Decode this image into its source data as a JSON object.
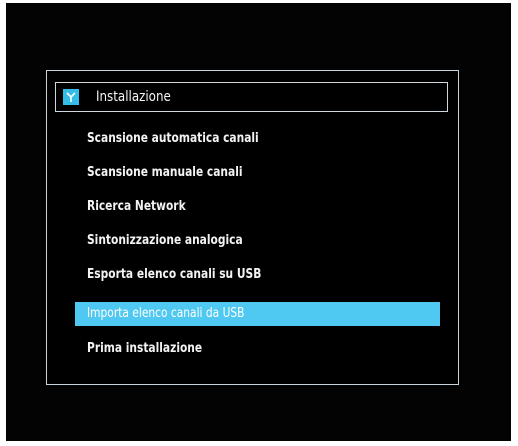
{
  "menu": {
    "title": "Installazione",
    "header_icon": "antenna-icon",
    "accent_color": "#4fc8f2",
    "selected_index": 5,
    "items": [
      {
        "label": "Scansione automatica canali"
      },
      {
        "label": "Scansione manuale canali"
      },
      {
        "label": "Ricerca Network"
      },
      {
        "label": "Sintonizzazione analogica"
      },
      {
        "label": "Esporta elenco canali su USB"
      },
      {
        "label": "Importa elenco canali da USB"
      },
      {
        "label": "Prima installazione"
      }
    ]
  }
}
